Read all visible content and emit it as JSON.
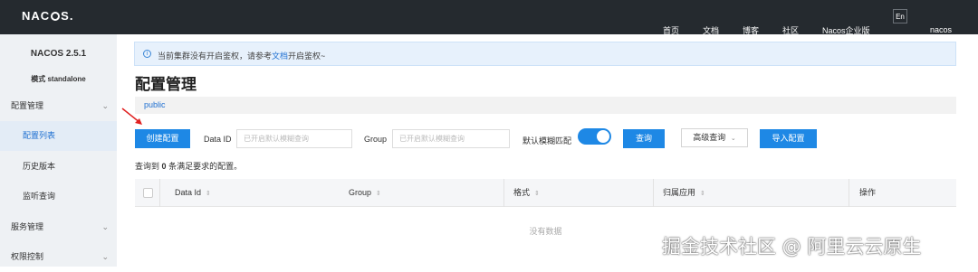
{
  "header": {
    "logo_text": "NACOS.",
    "nav": [
      {
        "label": "首页"
      },
      {
        "label": "文档"
      },
      {
        "label": "博客"
      },
      {
        "label": "社区"
      },
      {
        "label": "Nacos企业版"
      }
    ],
    "lang_button": "En",
    "user": "nacos",
    "bg_color": "#252a2f"
  },
  "sidebar": {
    "version": "NACOS 2.5.1",
    "mode": "模式 standalone",
    "items": [
      {
        "label": "配置管理",
        "level": 1,
        "expanded": true
      },
      {
        "label": "配置列表",
        "level": 2,
        "active": true
      },
      {
        "label": "历史版本",
        "level": 2
      },
      {
        "label": "监听查询",
        "level": 2
      },
      {
        "label": "服务管理",
        "level": 1
      },
      {
        "label": "权限控制",
        "level": 1
      }
    ]
  },
  "notice": {
    "text_before": "当前集群没有开启鉴权，请参考",
    "link": "文档",
    "text_after": "开启鉴权~",
    "icon": "info-icon"
  },
  "page": {
    "title": "配置管理",
    "namespace_tab": "public"
  },
  "toolbar": {
    "create_button": "创建配置",
    "data_id_label": "Data ID",
    "data_id_placeholder": "已开启默认模糊查询",
    "group_label": "Group",
    "group_placeholder": "已开启默认模糊查询",
    "fuzzy_label": "默认模糊匹配",
    "fuzzy_enabled": true,
    "search_button": "查询",
    "advanced_button": "高级查询",
    "import_button": "导入配置",
    "primary_color": "#1e88e5"
  },
  "results": {
    "prefix": "查询到",
    "count": "0",
    "suffix": "条满足要求的配置。"
  },
  "table": {
    "columns": [
      "Data Id",
      "Group",
      "格式",
      "归属应用",
      "操作"
    ],
    "empty_text": "没有数据"
  },
  "watermark": "掘金技术社区 @ 阿里云云原生"
}
